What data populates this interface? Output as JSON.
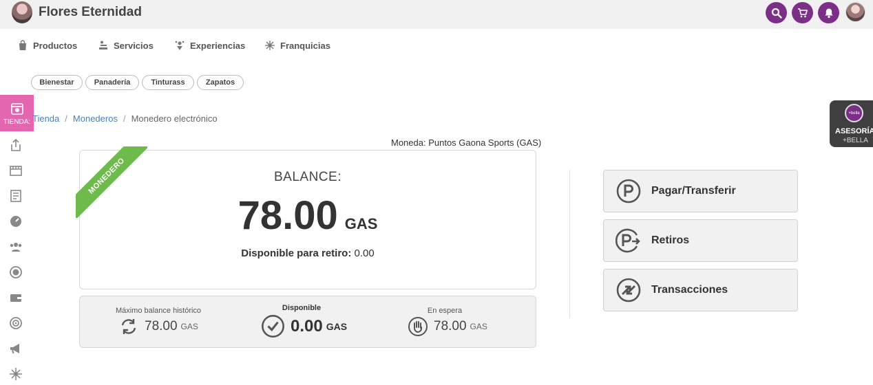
{
  "header": {
    "brand": "Flores Eternidad",
    "accent_color": "#7b2f86",
    "icons": [
      "search-icon",
      "cart-icon",
      "bell-icon"
    ]
  },
  "nav": {
    "items": [
      {
        "label": "Productos",
        "icon": "bag-icon"
      },
      {
        "label": "Servicios",
        "icon": "services-icon"
      },
      {
        "label": "Experiencias",
        "icon": "experience-icon"
      },
      {
        "label": "Franquicias",
        "icon": "network-icon"
      }
    ]
  },
  "chips": [
    "Bienestar",
    "Panadería",
    "Tinturass",
    "Zapatos"
  ],
  "sidebar": {
    "active_label": "TIENDA:",
    "active_color": "#e566b0",
    "icons": [
      "share-icon",
      "store-icon",
      "report-icon",
      "dashboard-icon",
      "team-icon",
      "coin-icon",
      "wallet-icon",
      "target-icon",
      "megaphone-icon",
      "network-icon"
    ]
  },
  "breadcrumb": {
    "items": [
      "Tienda",
      "Monederos",
      "Monedero electrónico"
    ],
    "separator": "/"
  },
  "moneda": "Moneda: Puntos Gaona Sports (GAS)",
  "balance": {
    "ribbon": "MONEDERO",
    "label": "BALANCE:",
    "amount": "78.00",
    "currency": "GAS",
    "retiro_label": "Disponible para retiro:",
    "retiro_value": "0.00"
  },
  "stats": {
    "max_title": "Máximo balance histórico",
    "max_value": "78.00",
    "max_unit": "GAS",
    "disp_title": "Disponible",
    "disp_value": "0.00",
    "disp_unit": "GAS",
    "wait_title": "En espera",
    "wait_value": "78.00",
    "wait_unit": "GAS"
  },
  "actions": {
    "pay": "Pagar/Transferir",
    "withdraw": "Retiros",
    "transactions": "Transacciones"
  },
  "asesoria": {
    "badge": "+bella",
    "title": "ASESORÍA:",
    "subtitle": "+BELLA"
  }
}
